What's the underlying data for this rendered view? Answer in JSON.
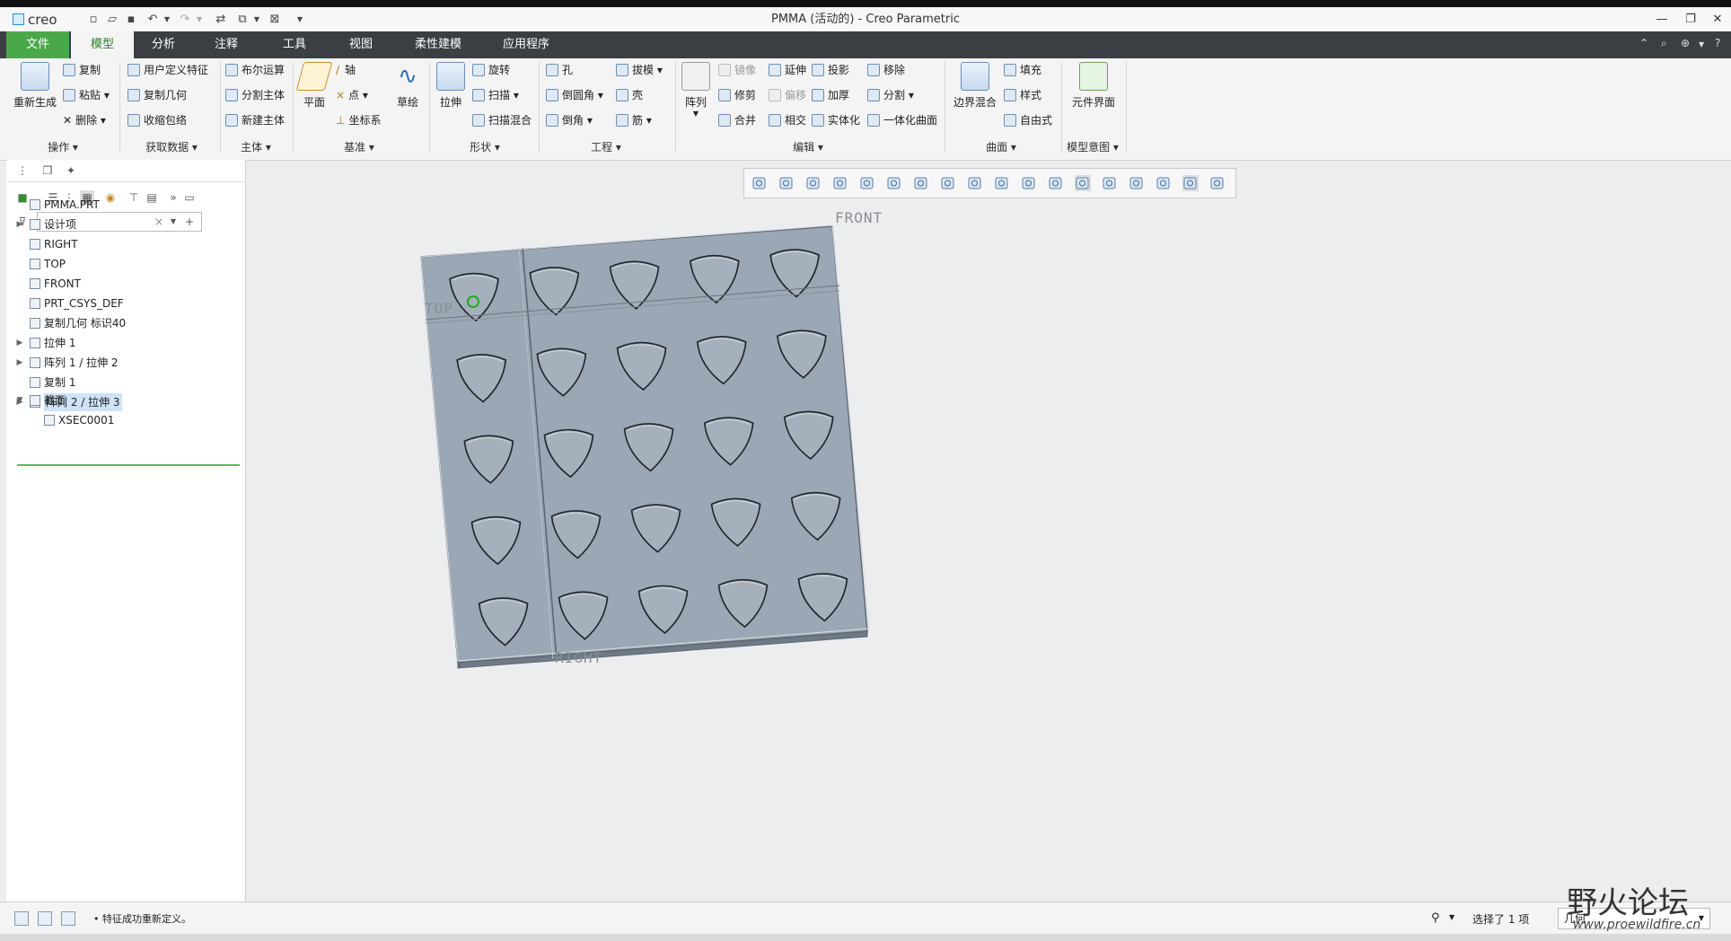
{
  "app": {
    "logo": "creo",
    "window_title": "PMMA (活动的) - Creo Parametric"
  },
  "window_controls": [
    "—",
    "❐",
    "✕"
  ],
  "tabs": [
    {
      "label": "文件"
    },
    {
      "label": "模型"
    },
    {
      "label": "分析"
    },
    {
      "label": "注释"
    },
    {
      "label": "工具"
    },
    {
      "label": "视图"
    },
    {
      "label": "柔性建模"
    },
    {
      "label": "应用程序"
    }
  ],
  "ribbon": {
    "regen": "重新生成",
    "op_small": [
      "复制",
      "粘贴",
      "删除"
    ],
    "get_data": [
      "用户定义特征",
      "复制几何",
      "收缩包络"
    ],
    "body": [
      "布尔运算",
      "分割主体",
      "新建主体"
    ],
    "datum_plane": "平面",
    "datum_small": [
      "轴",
      "点",
      "坐标系"
    ],
    "sketch": "草绘",
    "extrude": "拉伸",
    "shape_small": [
      "旋转",
      "扫描",
      "扫描混合"
    ],
    "eng_col1": [
      "孔",
      "倒圆角",
      "倒角"
    ],
    "eng_col2": [
      "拔模",
      "壳",
      "筋"
    ],
    "pattern": "阵列",
    "edit_col1": [
      "镜像",
      "修剪",
      "合并"
    ],
    "edit_col2": [
      "延伸",
      "偏移",
      "相交"
    ],
    "edit_col3": [
      "投影",
      "加厚",
      "实体化"
    ],
    "edit_col4": [
      "移除",
      "分割",
      "一体化曲面"
    ],
    "boundary_blend": "边界混合",
    "surface_small": [
      "填充",
      "样式",
      "自由式"
    ],
    "component_interface": "元件界面",
    "groups": [
      "操作",
      "获取数据",
      "主体",
      "基准",
      "形状",
      "工程",
      "编辑",
      "曲面",
      "模型意图"
    ]
  },
  "tree": [
    {
      "label": "PMMA.PRT",
      "expander": "",
      "indent": 0
    },
    {
      "label": "设计项",
      "expander": "▶",
      "indent": 1
    },
    {
      "label": "RIGHT",
      "expander": "",
      "indent": 1
    },
    {
      "label": "TOP",
      "expander": "",
      "indent": 1
    },
    {
      "label": "FRONT",
      "expander": "",
      "indent": 1
    },
    {
      "label": "PRT_CSYS_DEF",
      "expander": "",
      "indent": 1
    },
    {
      "label": "复制几何 标识40",
      "expander": "",
      "indent": 1
    },
    {
      "label": "拉伸 1",
      "expander": "▶",
      "indent": 1
    },
    {
      "label": "阵列 1 / 拉伸 2",
      "expander": "▶",
      "indent": 1
    },
    {
      "label": "复制 1",
      "expander": "",
      "indent": 1
    },
    {
      "label": "阵列 2 / 拉伸 3",
      "expander": "▶",
      "indent": 1
    }
  ],
  "sections_tree": [
    {
      "label": "截面",
      "expander": "▼"
    },
    {
      "label": "XSEC0001",
      "expander": ""
    }
  ],
  "graphics": {
    "plane_labels": [
      "FRONT",
      "TOP",
      "RIGHT"
    ],
    "plate_color": "#9ba7b4",
    "plate_edge_color": "#5f6873",
    "cutout_rows": 5,
    "cutout_cols": 5
  },
  "status": {
    "message": "• 特征成功重新定义。",
    "selected": "选择了 1 项",
    "filter": "几何"
  },
  "watermark": {
    "text": "野火论坛",
    "url": "www.proewildfire.cn"
  },
  "colors": {
    "file_tab": "#4aa84a",
    "tab_bar": "#3b3f44",
    "selection": "#cfe3f8"
  }
}
